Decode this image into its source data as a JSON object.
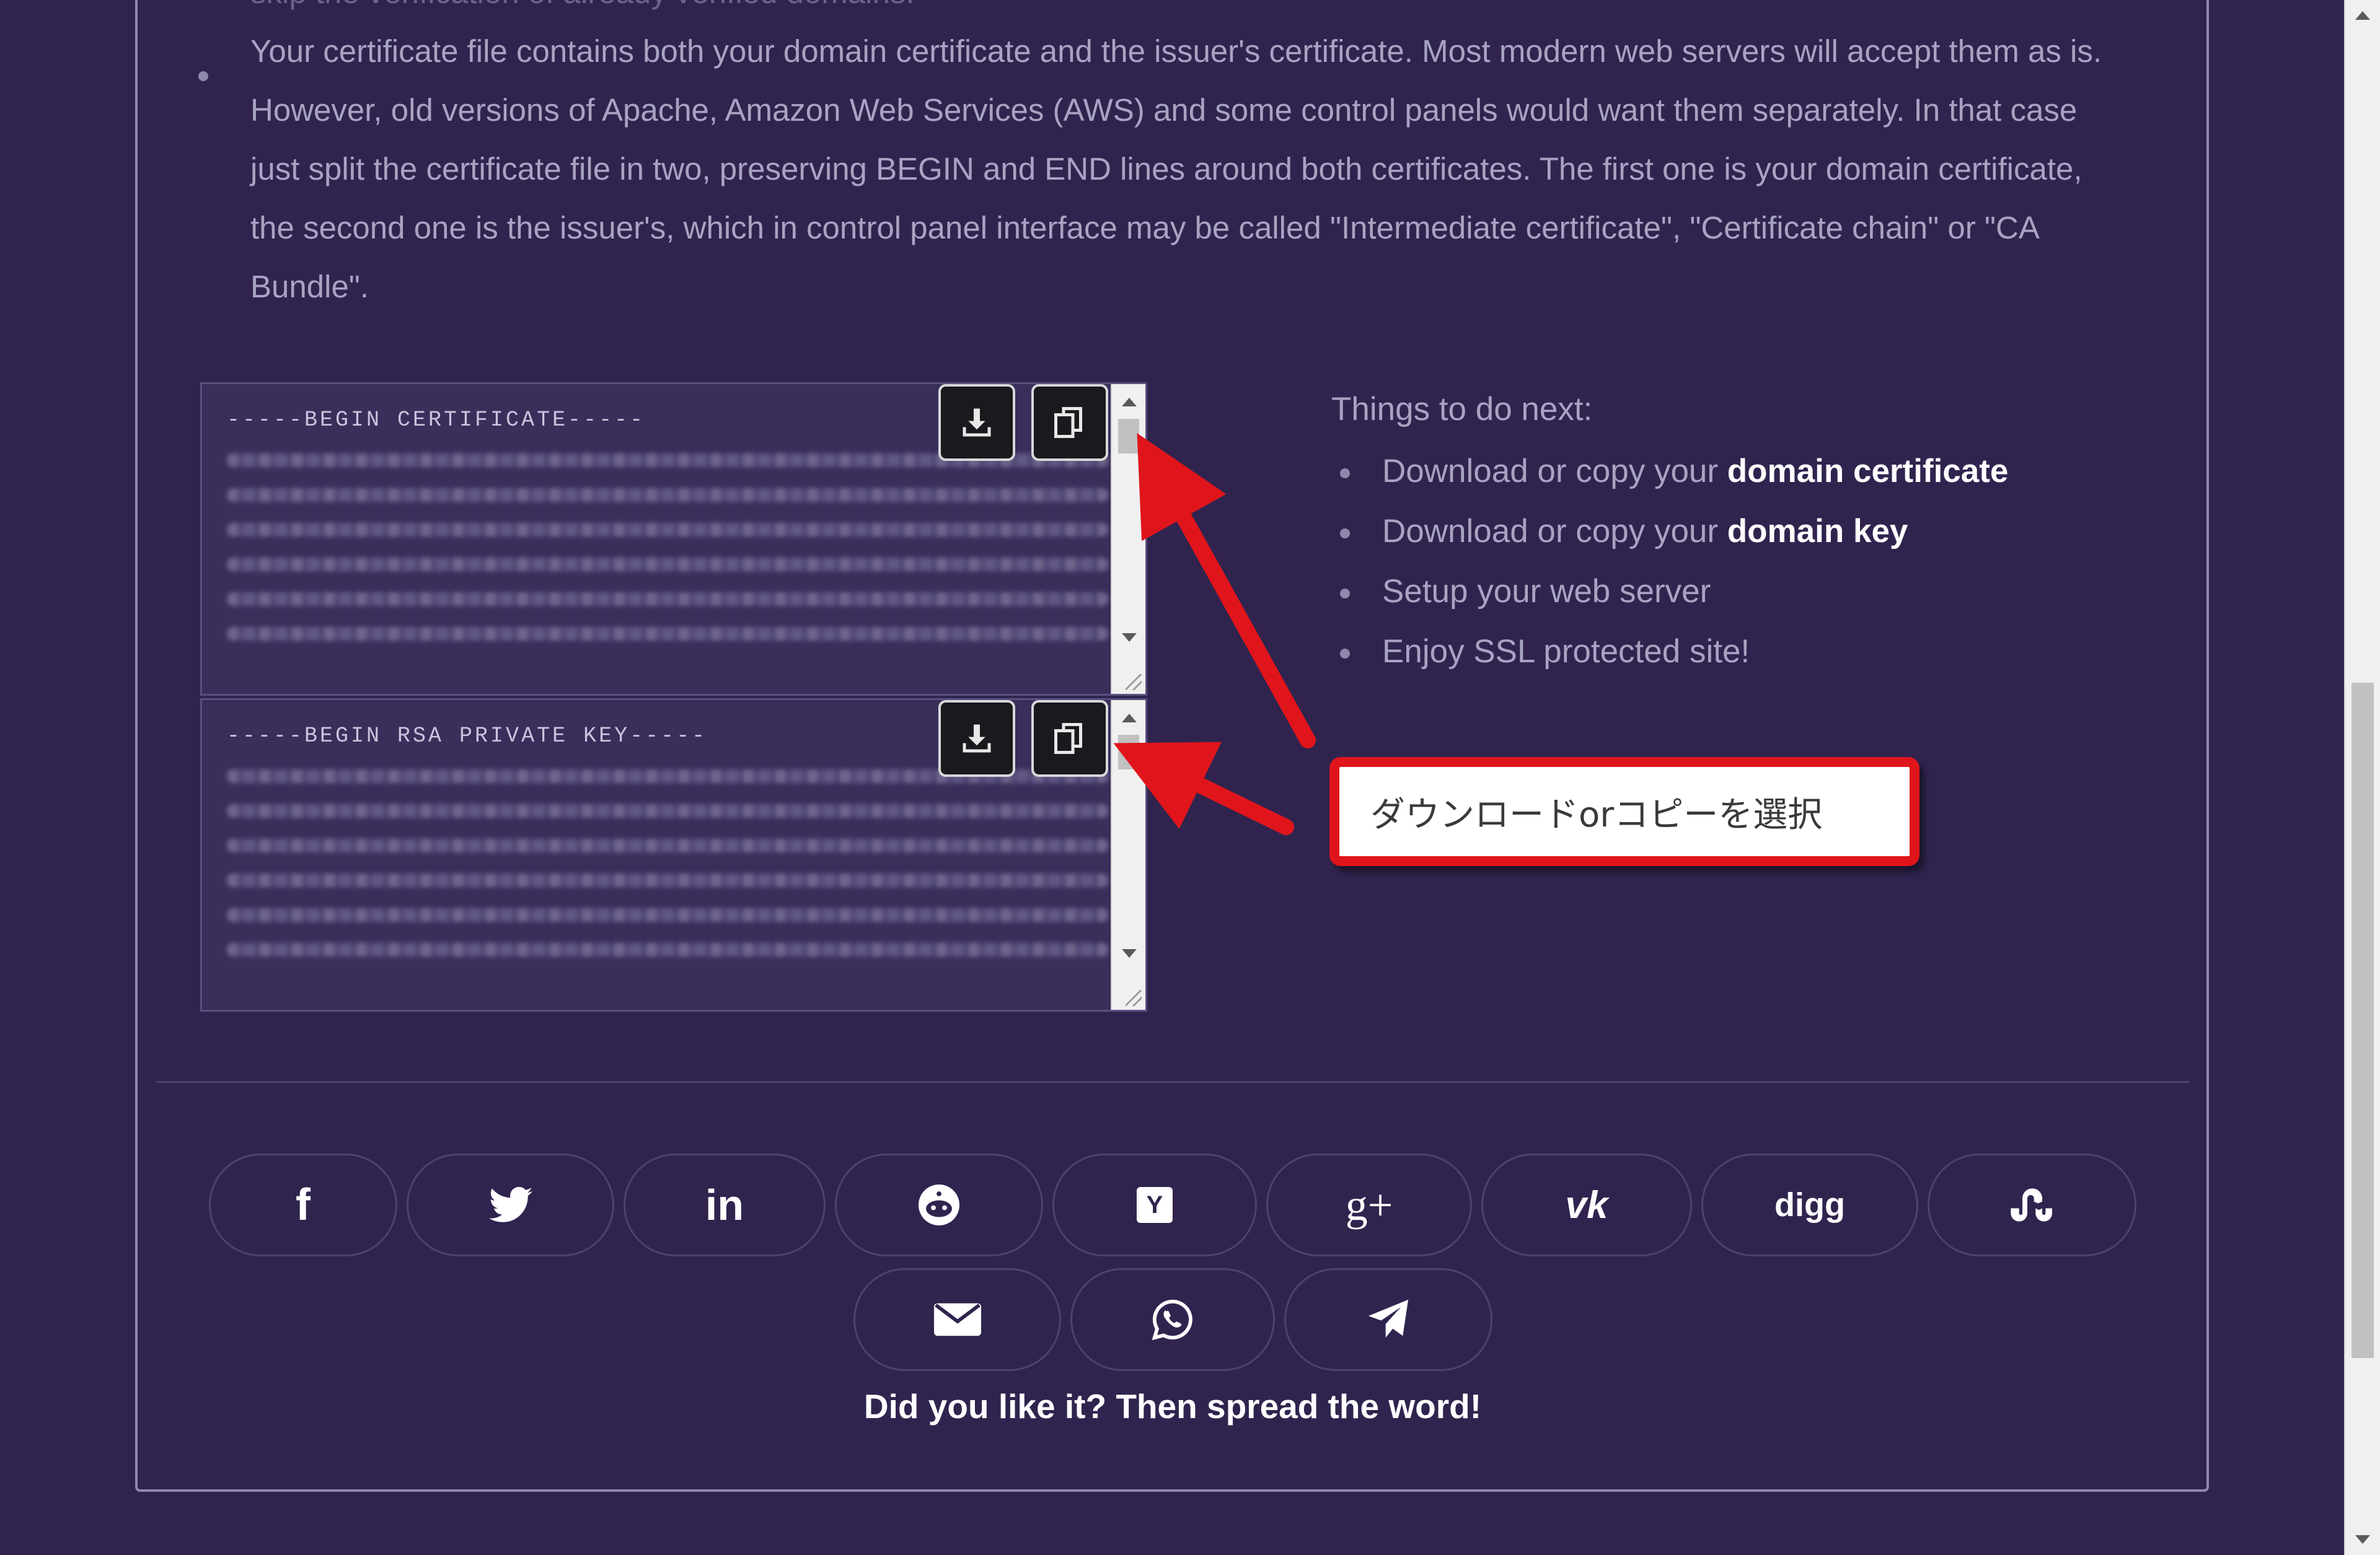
{
  "instructions": {
    "prev_item": "skip the verification of already verified domains.",
    "cert_file_note": "Your certificate file contains both your domain certificate and the issuer's certificate. Most modern web servers will accept them as is. However, old versions of Apache, Amazon Web Services (AWS) and some control panels would want them separately. In that case just split the certificate file in two, preserving BEGIN and END lines around both certificates. The first one is your domain certificate, the second one is the issuer's, which in control panel interface may be called \"Intermediate certificate\", \"Certificate chain\" or \"CA Bundle\"."
  },
  "certificate_box": {
    "header": "-----BEGIN CERTIFICATE-----"
  },
  "key_box": {
    "header": "-----BEGIN RSA PRIVATE KEY-----"
  },
  "next_steps": {
    "title": "Things to do next:",
    "items": [
      {
        "text": "Download or copy your ",
        "bold": "domain certificate"
      },
      {
        "text": "Download or copy your ",
        "bold": "domain key"
      },
      {
        "text": "Setup your web server",
        "bold": ""
      },
      {
        "text": "Enjoy SSL protected site!",
        "bold": ""
      }
    ]
  },
  "callout": {
    "text": "ダウンロードorコピーを選択",
    "border_color": "#e0151b",
    "arrow_color": "#e0151b"
  },
  "share": {
    "buttons": [
      {
        "name": "facebook",
        "label": "f"
      },
      {
        "name": "twitter",
        "label": ""
      },
      {
        "name": "linkedin",
        "label": "in"
      },
      {
        "name": "reddit",
        "label": ""
      },
      {
        "name": "hacker-news",
        "label": "Y"
      },
      {
        "name": "google-plus",
        "label": "g+"
      },
      {
        "name": "vk",
        "label": "vk"
      },
      {
        "name": "digg",
        "label": "digg"
      },
      {
        "name": "stumbleupon",
        "label": ""
      },
      {
        "name": "email",
        "label": ""
      },
      {
        "name": "whatsapp",
        "label": ""
      },
      {
        "name": "telegram",
        "label": ""
      }
    ],
    "cta": "Did you like it? Then spread the word!"
  },
  "colors": {
    "background": "#30244f",
    "text": "#a8a3c2",
    "accent": "#ffffff"
  }
}
